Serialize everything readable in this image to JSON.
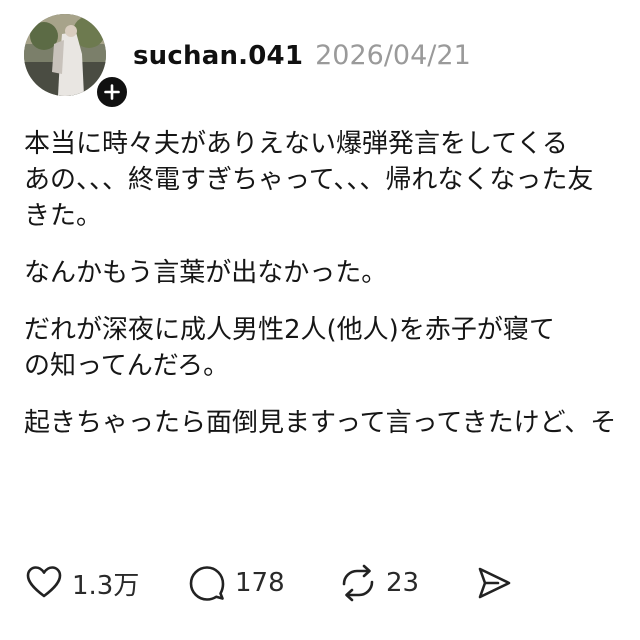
{
  "post": {
    "username": "suchan.041",
    "date": "2026/04/21",
    "paragraphs": [
      [
        "本当に時々夫がありえない爆弾発言をしてくる",
        "あの、、、終電すぎちゃって、、、帰れなくなった友",
        "きた。"
      ],
      [
        "なんかもう言葉が出なかった。"
      ],
      [
        "だれが深夜に成人男性2人(他人)を赤子が寝て",
        "の知ってんだろ。"
      ],
      [
        "起きちゃったら面倒見ますって言ってきたけど、そ"
      ]
    ],
    "actions": {
      "likes": "1.3万",
      "comments": "178",
      "reposts": "23"
    }
  },
  "icons": {
    "avatar": "avatar-photo",
    "follow": "plus-icon",
    "like": "heart-icon",
    "comment": "speech-bubble-icon",
    "repost": "repost-icon",
    "share": "send-icon"
  },
  "colors": {
    "text": "#101010",
    "muted": "#9a9a9a",
    "background": "#ffffff"
  }
}
